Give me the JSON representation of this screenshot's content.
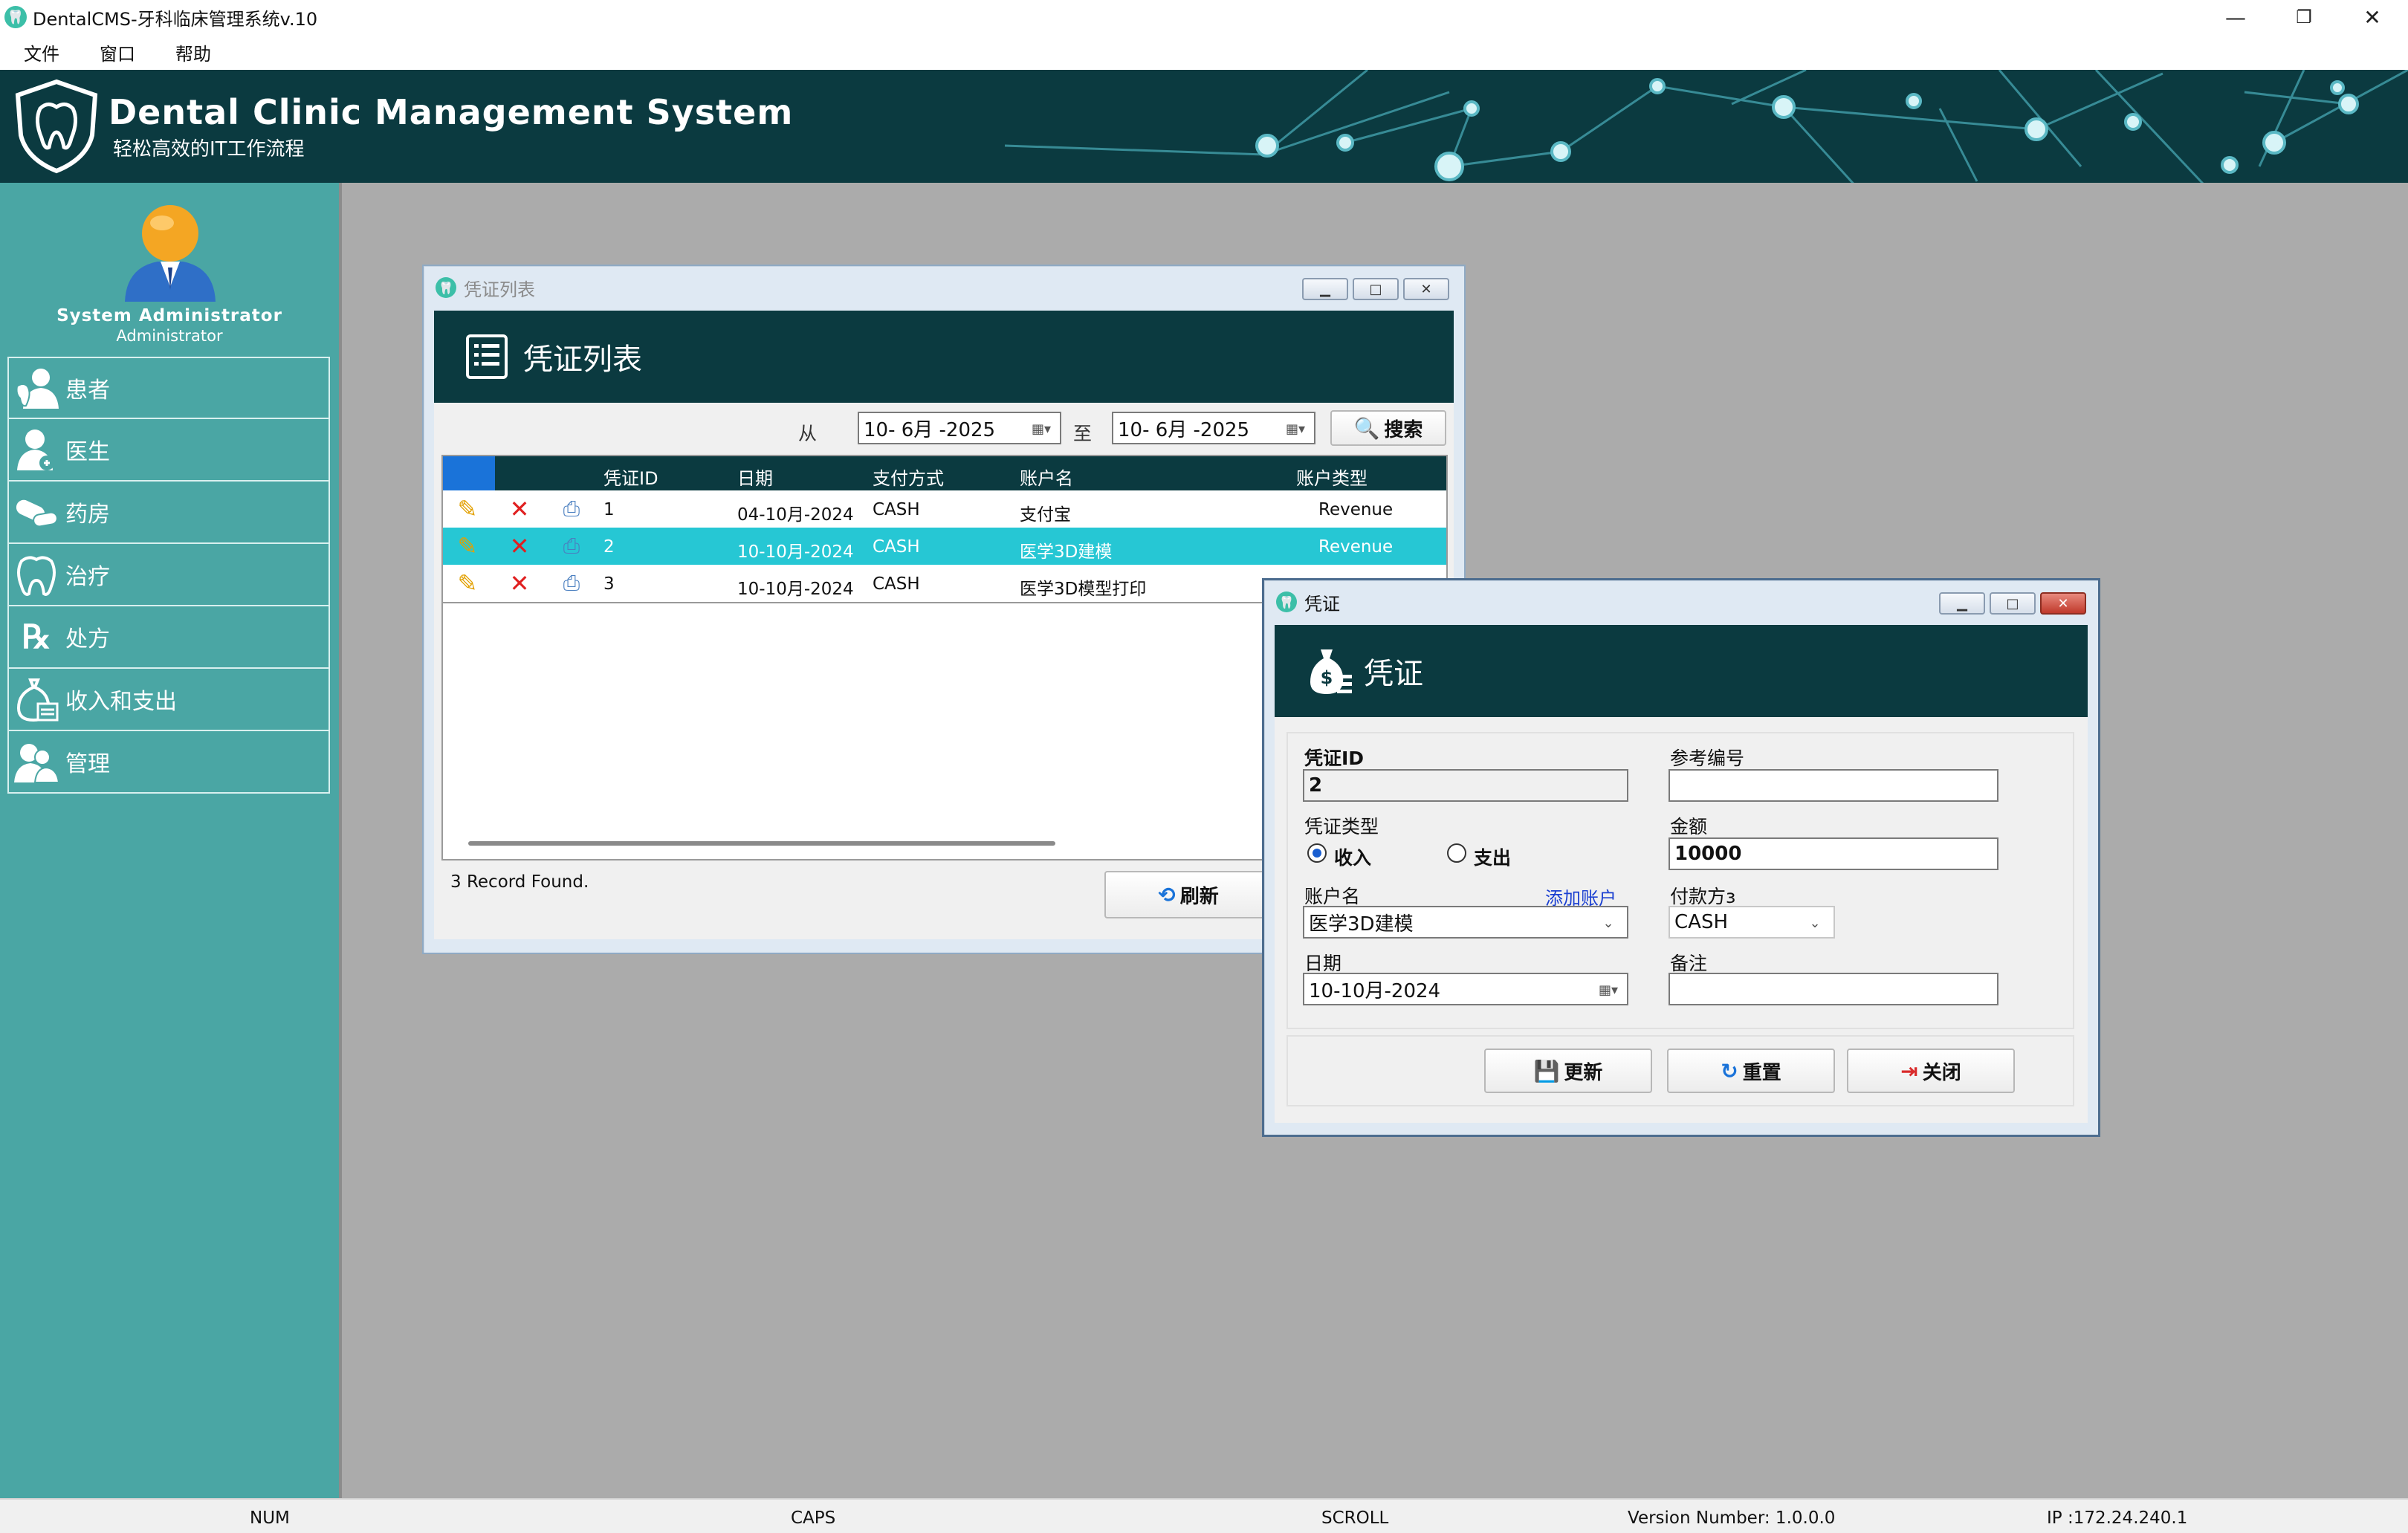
{
  "app": {
    "title": "DentalCMS-牙科临床管理系统v.10",
    "menu": [
      "文件",
      "窗口",
      "帮助"
    ]
  },
  "banner": {
    "title": "Dental Clinic Management System",
    "subtitle": "轻松高效的IT工作流程"
  },
  "user": {
    "name": "System Administrator",
    "role": "Administrator"
  },
  "sidebar": {
    "items": [
      {
        "label": "患者",
        "icon": "patient-icon"
      },
      {
        "label": "医生",
        "icon": "doctor-icon"
      },
      {
        "label": "药房",
        "icon": "pharmacy-icon"
      },
      {
        "label": "治疗",
        "icon": "treatment-icon"
      },
      {
        "label": "处方",
        "icon": "prescription-icon"
      },
      {
        "label": "收入和支出",
        "icon": "finance-icon"
      },
      {
        "label": "管理",
        "icon": "admin-icon"
      }
    ]
  },
  "voucher_list": {
    "window_title": "凭证列表",
    "header_title": "凭证列表",
    "from_label": "从",
    "to_label": "至",
    "from_date": "10- 6月 -2025",
    "to_date": "10- 6月 -2025",
    "search_label": "搜索",
    "columns": [
      "凭证ID",
      "日期",
      "支付方式",
      "账户名",
      "账户类型"
    ],
    "rows": [
      {
        "id": "1",
        "date": "04-10月-2024",
        "method": "CASH",
        "account": "支付宝",
        "type": "Revenue",
        "selected": false
      },
      {
        "id": "2",
        "date": "10-10月-2024",
        "method": "CASH",
        "account": "医学3D建模",
        "type": "Revenue",
        "selected": true
      },
      {
        "id": "3",
        "date": "10-10月-2024",
        "method": "CASH",
        "account": "医学3D模型打印",
        "type": "",
        "selected": false
      }
    ],
    "record_count": "3 Record Found.",
    "refresh_label": "刷新"
  },
  "voucher": {
    "window_title": "凭证",
    "header_title": "凭证",
    "id_label": "凭证ID",
    "id_value": "2",
    "ref_label": "参考编号",
    "ref_value": "",
    "type_label": "凭证类型",
    "income_label": "收入",
    "expense_label": "支出",
    "amount_label": "金额",
    "amount_value": "10000",
    "account_label": "账户名",
    "add_account_link": "添加账户",
    "account_value": "医学3D建模",
    "payment_label": "付款方ɜ",
    "payment_value": "CASH",
    "date_label": "日期",
    "date_value": "10-10月-2024",
    "note_label": "备注",
    "note_value": "",
    "update_label": "更新",
    "reset_label": "重置",
    "close_label": "关闭"
  },
  "status": {
    "num": "NUM",
    "caps": "CAPS",
    "scroll": "SCROLL",
    "version": "Version Number: 1.0.0.0",
    "ip": "IP :172.24.240.1"
  },
  "colors": {
    "banner_bg": "#0b3a40",
    "sidebar_bg": "#4aa6a4",
    "workspace_bg": "#ababab",
    "selected_row": "#26c7d4",
    "grid_header": "#0b3a40"
  }
}
